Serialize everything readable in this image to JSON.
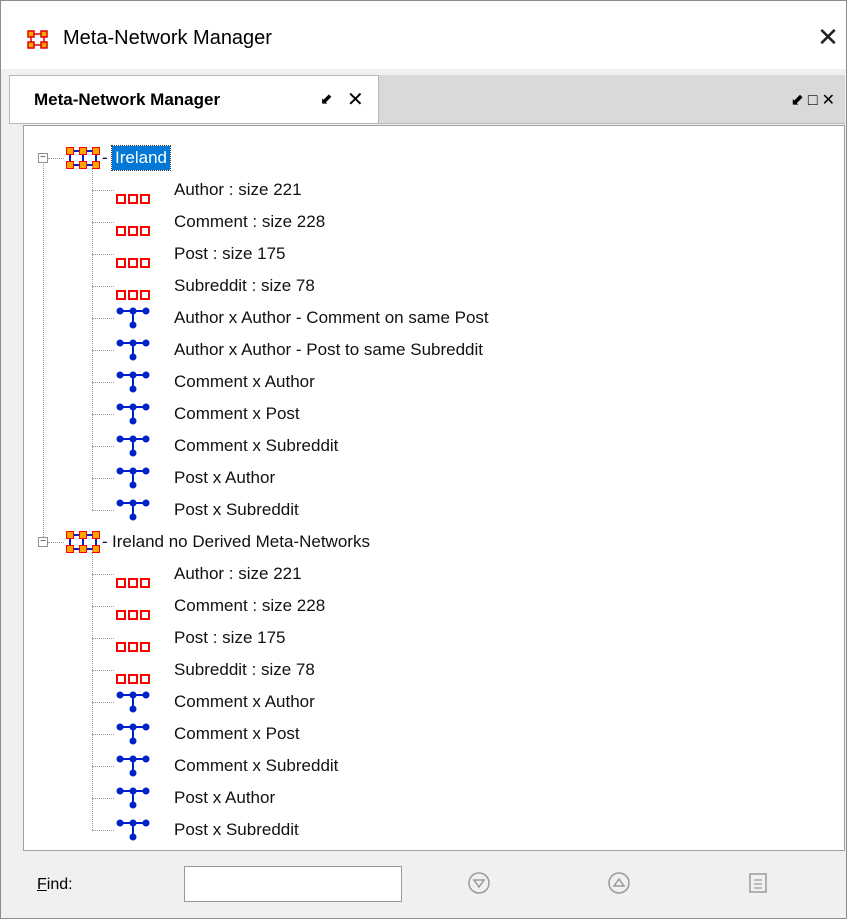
{
  "window": {
    "title": "Meta-Network Manager",
    "close_glyph": "✕"
  },
  "tab": {
    "label": "Meta-Network Manager",
    "pin_glyph": "⬋",
    "close_glyph": "✕"
  },
  "strip_buttons": {
    "pin": "⬋",
    "maximize": "□",
    "close": "✕"
  },
  "tree": [
    {
      "label": "Ireland",
      "selected": true,
      "children": [
        {
          "type": "nodeset",
          "label": "Author : size 221"
        },
        {
          "type": "nodeset",
          "label": "Comment : size 228"
        },
        {
          "type": "nodeset",
          "label": "Post : size 175"
        },
        {
          "type": "nodeset",
          "label": "Subreddit : size 78"
        },
        {
          "type": "network",
          "label": "Author x Author - Comment on same Post"
        },
        {
          "type": "network",
          "label": "Author x Author - Post to same Subreddit"
        },
        {
          "type": "network",
          "label": "Comment x Author"
        },
        {
          "type": "network",
          "label": "Comment x Post"
        },
        {
          "type": "network",
          "label": "Comment x Subreddit"
        },
        {
          "type": "network",
          "label": "Post x Author"
        },
        {
          "type": "network",
          "label": "Post x Subreddit"
        }
      ]
    },
    {
      "label": "Ireland no Derived Meta-Networks",
      "selected": false,
      "children": [
        {
          "type": "nodeset",
          "label": "Author : size 221"
        },
        {
          "type": "nodeset",
          "label": "Comment : size 228"
        },
        {
          "type": "nodeset",
          "label": "Post : size 175"
        },
        {
          "type": "nodeset",
          "label": "Subreddit : size 78"
        },
        {
          "type": "network",
          "label": "Comment x Author"
        },
        {
          "type": "network",
          "label": "Comment x Post"
        },
        {
          "type": "network",
          "label": "Comment x Subreddit"
        },
        {
          "type": "network",
          "label": "Post x Author"
        },
        {
          "type": "network",
          "label": "Post x Subreddit"
        }
      ]
    }
  ],
  "find": {
    "label": "Find:",
    "value": "",
    "placeholder": ""
  },
  "icons": {
    "app": "meta-network-icon",
    "root": "meta-network-icon",
    "nodeset": "nodeset-icon",
    "network": "network-icon",
    "find_next": "find-next-icon",
    "find_prev": "find-previous-icon",
    "find_list": "find-list-icon"
  },
  "colors": {
    "selection": "#0078d7",
    "nodeset": "#ff0000",
    "network": "#0022cc",
    "meta_network": "#ffa500"
  }
}
